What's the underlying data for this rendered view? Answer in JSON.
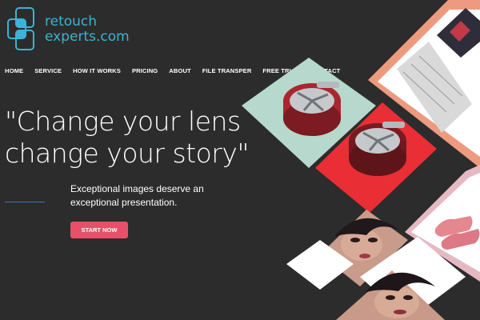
{
  "brand": {
    "line1": "retouch",
    "line2": "experts.com"
  },
  "nav": [
    {
      "label": "HOME"
    },
    {
      "label": "SERVICE"
    },
    {
      "label": "HOW IT WORKS"
    },
    {
      "label": "PRICING"
    },
    {
      "label": "ABOUT"
    },
    {
      "label": "FILE TRANSPER"
    },
    {
      "label": "FREE TRIAL"
    },
    {
      "label": "CONTACT"
    }
  ],
  "hero": {
    "headline_line1": "\"Change your lens",
    "headline_line2": "change your story\"",
    "sub_line1": "Exceptional images deserve an",
    "sub_line2": "exceptional presentation.",
    "cta_label": "START NOW"
  },
  "colors": {
    "background": "#2c2c2c",
    "brand": "#3ab4d6",
    "cta": "#e8506a",
    "accent_line": "#3b6fc6"
  },
  "icons": {
    "logo": "overlapping-squares-logo-icon"
  }
}
